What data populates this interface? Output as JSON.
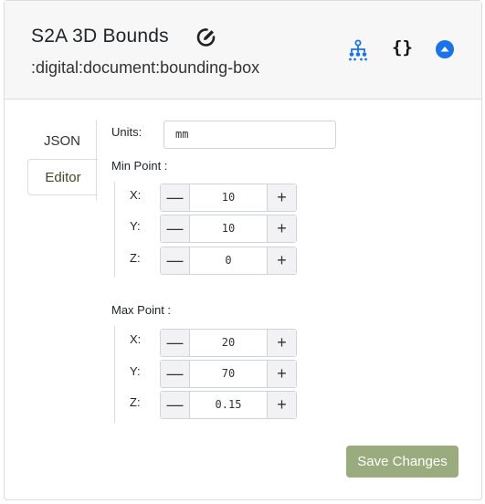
{
  "header": {
    "title": "S2A 3D Bounds",
    "subtitle": ":digital:document:bounding-box",
    "icons": [
      "edit-icon",
      "hierarchy-icon",
      "json-braces-icon",
      "collapse-up-icon"
    ],
    "json_icon_text": "{}",
    "accent_color": "#1a73e8"
  },
  "tabs": [
    {
      "label": "JSON",
      "active": false
    },
    {
      "label": "Editor",
      "active": true
    }
  ],
  "editor": {
    "units_label": "Units:",
    "units_value": "mm",
    "min_point": {
      "label": "Min Point :",
      "fields": [
        {
          "axis": "X:",
          "value": "10"
        },
        {
          "axis": "Y:",
          "value": "10"
        },
        {
          "axis": "Z:",
          "value": "0"
        }
      ]
    },
    "max_point": {
      "label": "Max Point :",
      "fields": [
        {
          "axis": "X:",
          "value": "20"
        },
        {
          "axis": "Y:",
          "value": "70"
        },
        {
          "axis": "Z:",
          "value": "0.15"
        }
      ]
    },
    "minus_symbol": "—",
    "plus_symbol": "+",
    "save_label": "Save Changes",
    "save_color": "#9aab7d"
  }
}
